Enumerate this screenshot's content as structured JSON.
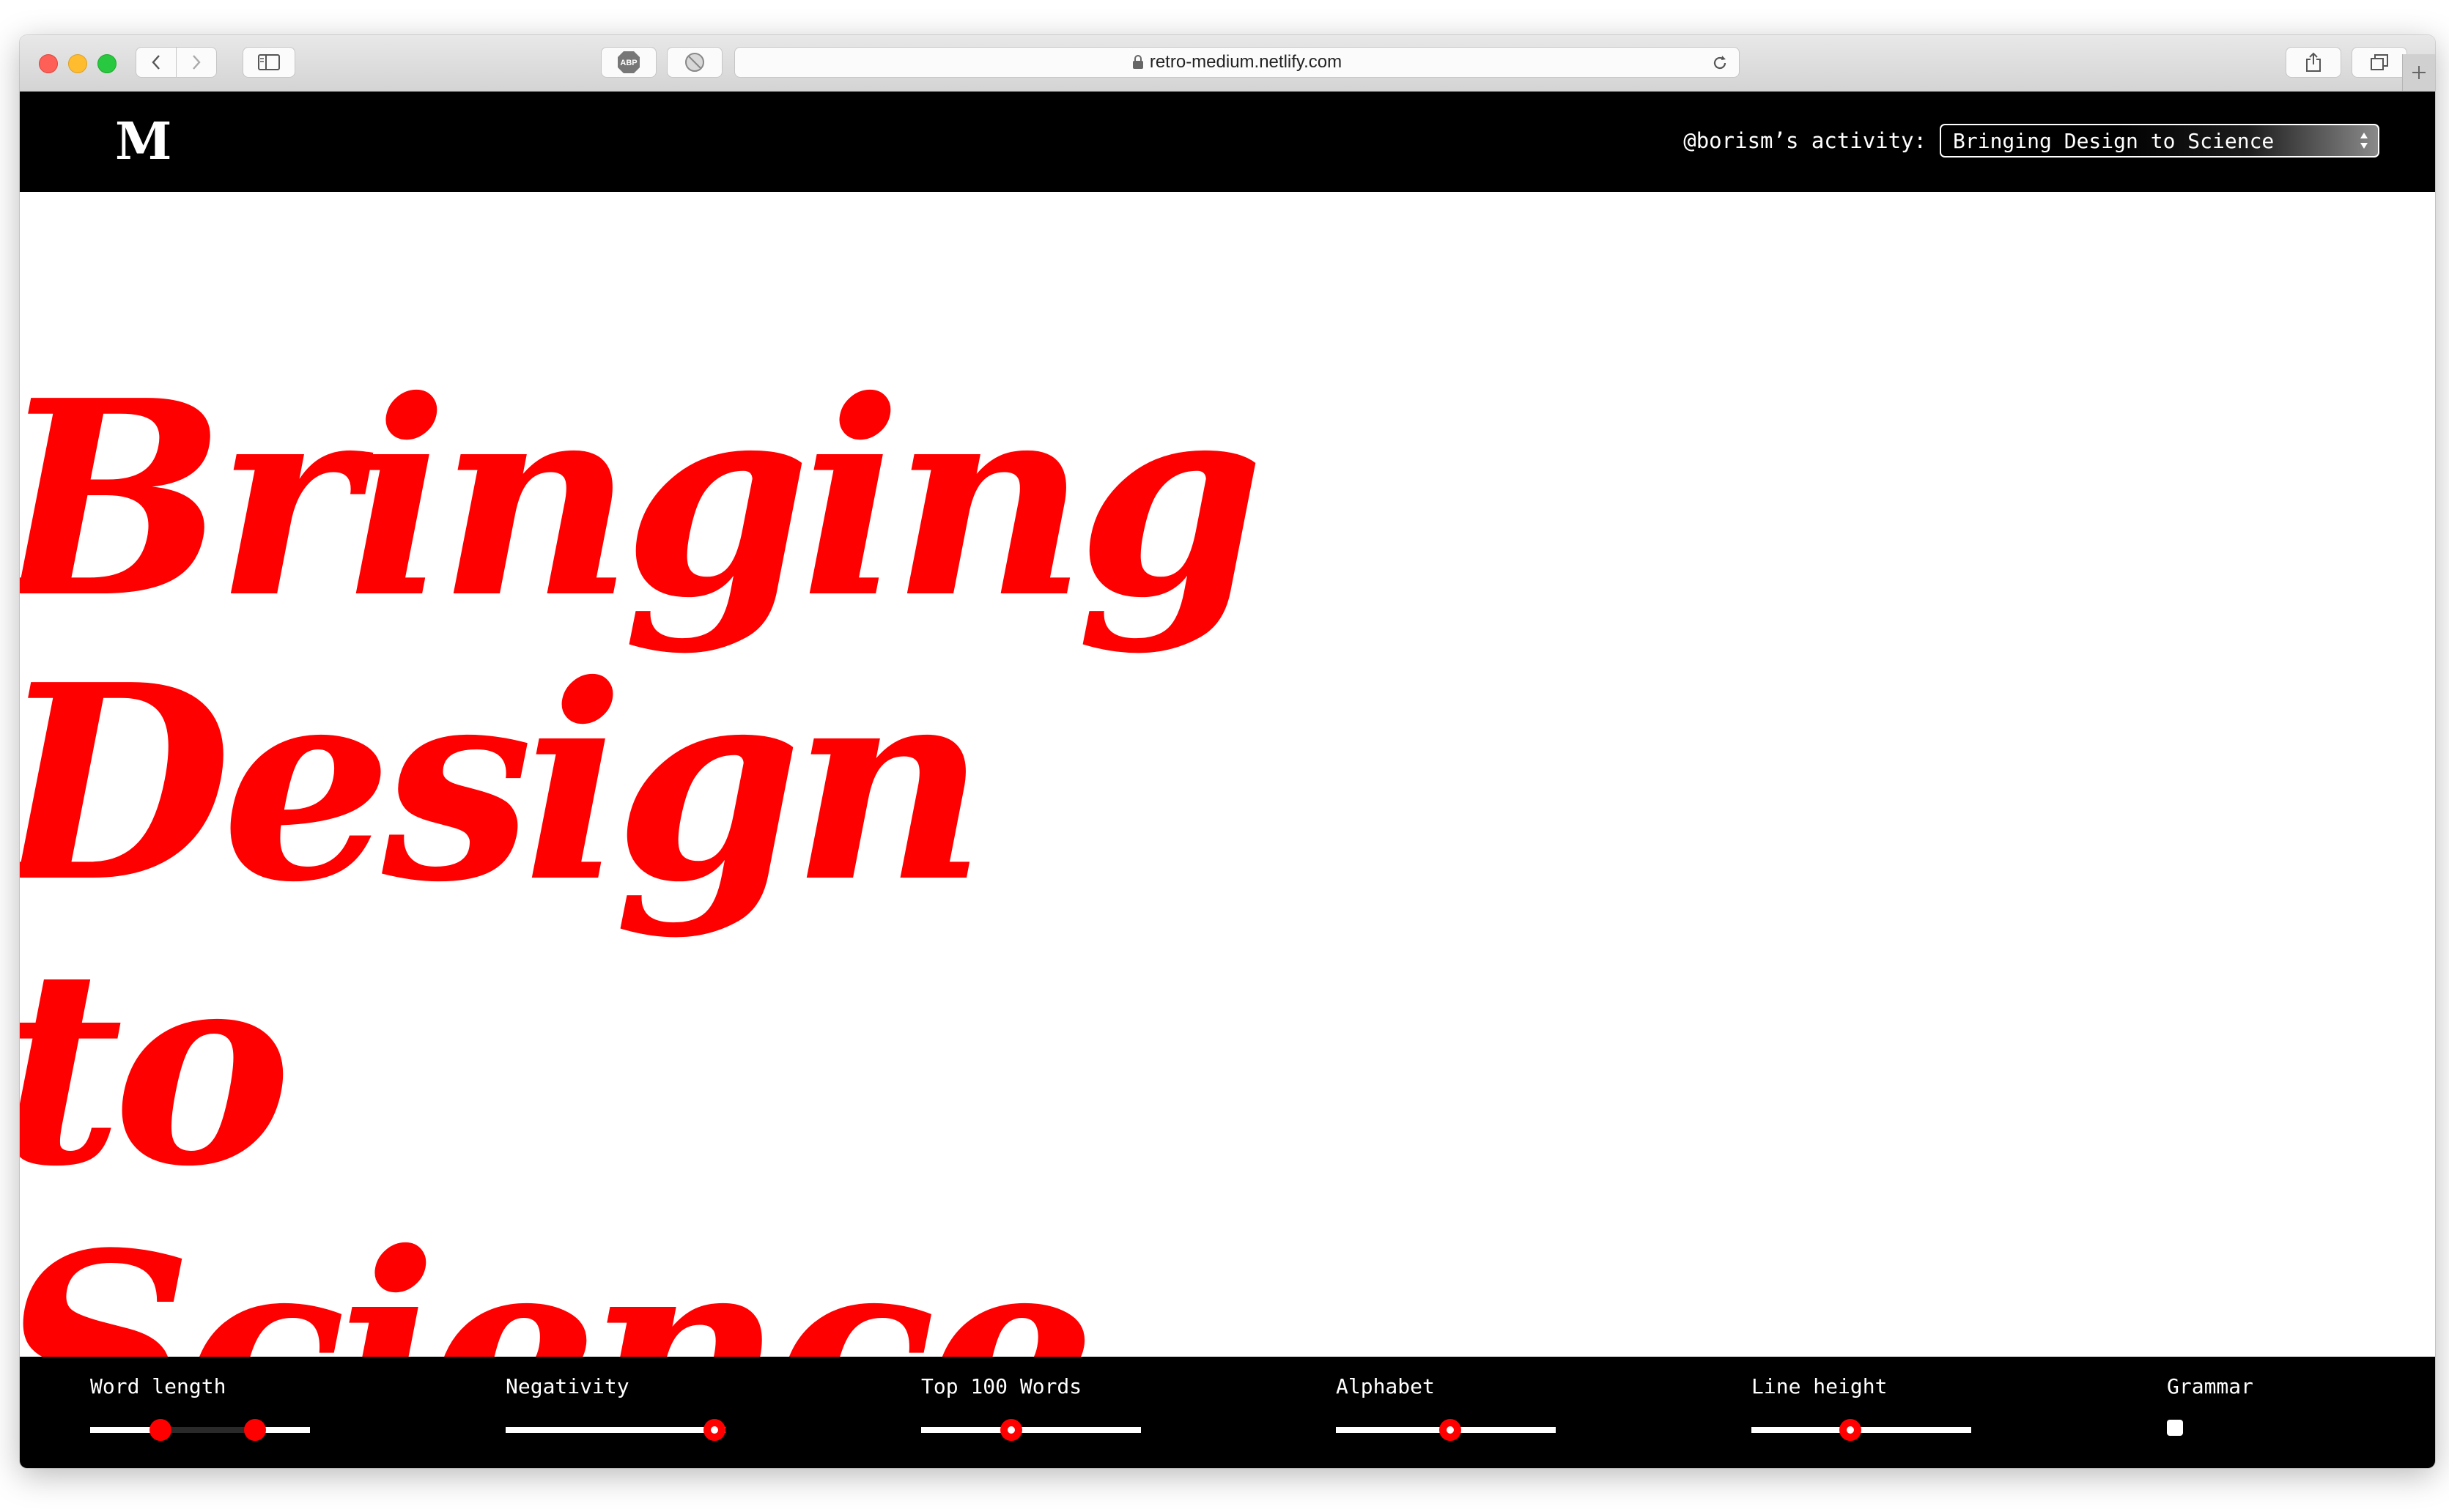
{
  "browser": {
    "url": "retro-medium.netlify.com"
  },
  "header": {
    "logo": "M",
    "activity_label": "@borism’s activity:",
    "selected_story": "Bringing Design to Science"
  },
  "hero": {
    "lines": [
      "Bringing",
      "Design to",
      "Science"
    ],
    "color": "#ff0000"
  },
  "controls": {
    "word_length": {
      "label": "Word length",
      "range_low": 0.32,
      "range_high": 0.75
    },
    "negativity": {
      "label": "Negativity",
      "value": 0.95
    },
    "top_100_words": {
      "label": "Top 100 Words",
      "value": 0.41
    },
    "alphabet": {
      "label": "Alphabet",
      "value": 0.52
    },
    "line_height": {
      "label": "Line height",
      "value": 0.45
    },
    "grammar": {
      "label": "Grammar",
      "checked": false
    }
  },
  "colors": {
    "accent": "#ff0000",
    "chrome_bg": "#000000"
  },
  "icons": [
    "back-icon",
    "forward-icon",
    "sidebar-icon",
    "adblock-icon",
    "blocker-icon",
    "lock-icon",
    "reload-icon",
    "share-icon",
    "tabs-icon",
    "new-tab-icon",
    "select-arrows-icon"
  ]
}
